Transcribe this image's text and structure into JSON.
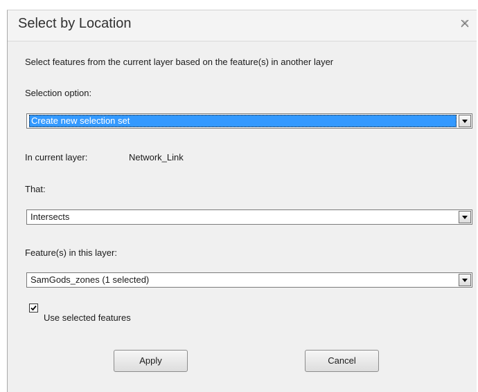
{
  "dialog": {
    "title": "Select by Location",
    "close_icon": "close-icon"
  },
  "description": "Select features from the current layer based on the feature(s) in another layer",
  "selection_option": {
    "label": "Selection option:",
    "value": "Create new selection set"
  },
  "current_layer": {
    "label": "In current layer:",
    "value": "Network_Link"
  },
  "that": {
    "label": "That:",
    "value": "Intersects"
  },
  "feature_layer": {
    "label": "Feature(s) in this layer:",
    "value": "SamGods_zones (1 selected)"
  },
  "use_selected": {
    "label": "Use selected features",
    "checked": true
  },
  "buttons": {
    "apply": "Apply",
    "cancel": "Cancel"
  },
  "colors": {
    "highlight": "#3399ff",
    "dialog_bg": "#f0f0f0"
  }
}
